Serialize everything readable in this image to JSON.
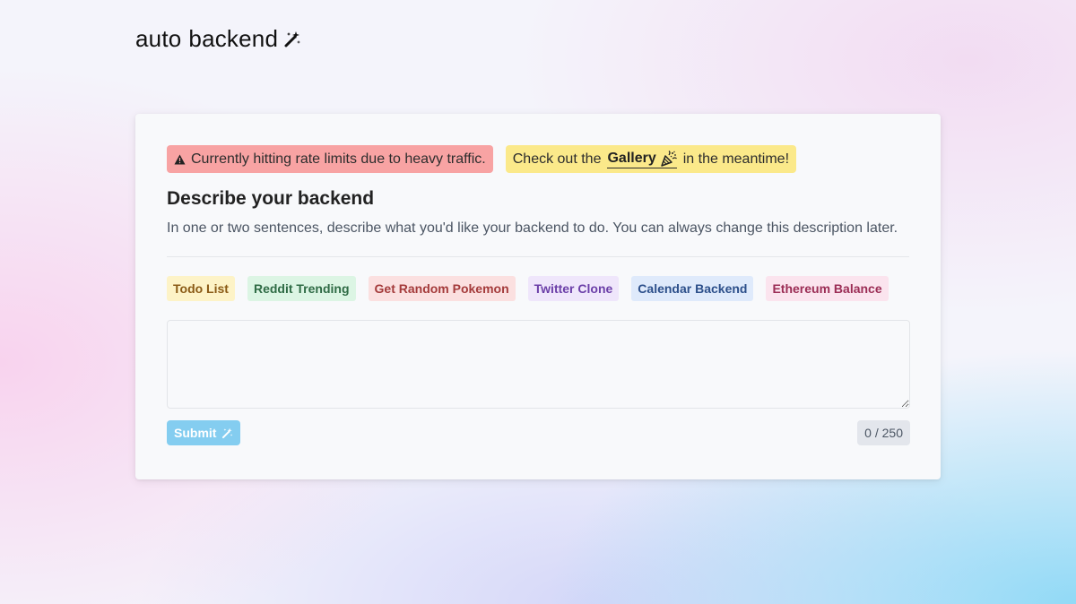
{
  "logo": {
    "part1": "auto",
    "part2": "backend",
    "icon": "magic-wand-icon"
  },
  "notices": {
    "warning_text": "Currently hitting rate limits due to heavy traffic.",
    "warning_icon": "warning-triangle-icon",
    "info_prefix": "Check out the",
    "gallery_label": "Gallery",
    "gallery_icon": "party-popper-icon",
    "info_suffix": "in the meantime!"
  },
  "form": {
    "heading": "Describe your backend",
    "subtext": "In one or two sentences, describe what you'd like your backend to do. You can always change this description later.",
    "examples": [
      {
        "label": "Todo List"
      },
      {
        "label": "Reddit Trending"
      },
      {
        "label": "Get Random Pokemon"
      },
      {
        "label": "Twitter Clone"
      },
      {
        "label": "Calendar Backend"
      },
      {
        "label": "Ethereum Balance"
      }
    ],
    "description_value": "",
    "submit_label": "Submit",
    "submit_icon": "magic-wand-icon",
    "char_count": "0 / 250"
  },
  "colors": {
    "warning_bg": "#f8a3a3",
    "info_bg": "#fbe98a",
    "submit_bg": "#84cdf0"
  }
}
